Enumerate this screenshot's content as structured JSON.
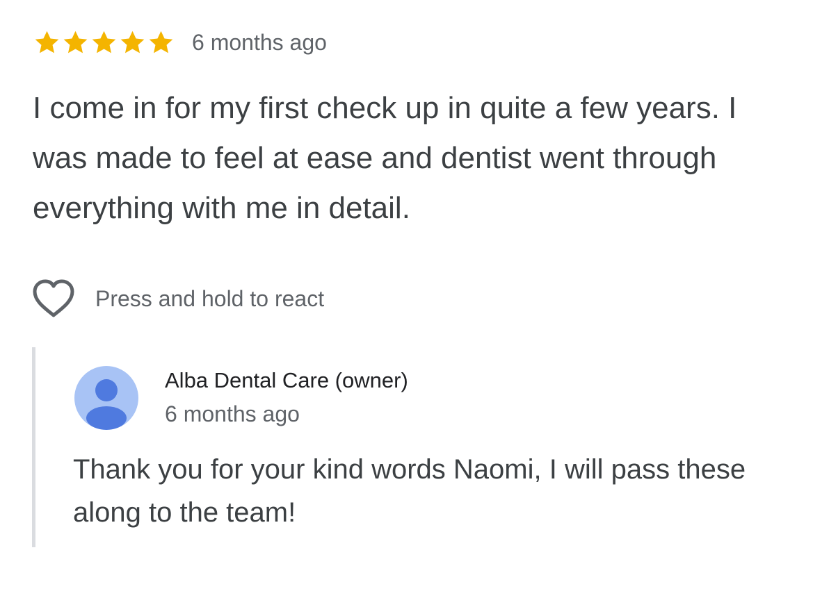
{
  "review": {
    "rating": 5,
    "max_rating": 5,
    "star_color": "#f4b400",
    "date": "6 months ago",
    "text": "I come in for my first check up in quite a few years. I was made to feel at ease and dentist went through everything with me in detail."
  },
  "reaction": {
    "icon": "heart-outline-icon",
    "label": "Press and hold to react"
  },
  "owner_reply": {
    "name": "Alba Dental Care (owner)",
    "date": "6 months ago",
    "avatar_icon": "person-icon",
    "avatar_bg": "#a8c3f5",
    "avatar_fg": "#4f7adf",
    "text": "Thank you for your kind words Naomi, I will pass these along to the team!"
  }
}
